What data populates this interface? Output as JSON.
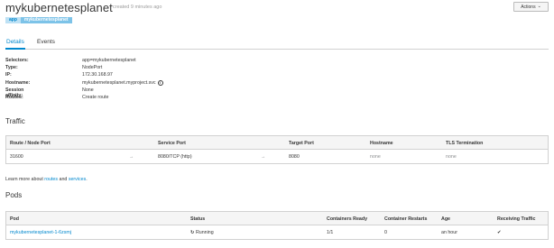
{
  "header": {
    "title": "mykubernetesplanet",
    "subtitle": "created 9 minutes ago",
    "actions_label": "Actions",
    "actions_caret": "⌄"
  },
  "labels": [
    {
      "key": "app",
      "value": "mykubernetesplanet"
    }
  ],
  "tabs": [
    {
      "label": "Details",
      "active": true
    },
    {
      "label": "Events",
      "active": false
    }
  ],
  "details": [
    {
      "key": "Selectors:",
      "value": "app=mykubernetesplanet"
    },
    {
      "key": "Type:",
      "value": "NodePort"
    },
    {
      "key": "IP:",
      "value": "172.30.168.97"
    },
    {
      "key": "Hostname:",
      "value": "mykubernetesplanet.myproject.svc",
      "info_icon": "i"
    },
    {
      "key": "Session affinity:",
      "value": "None"
    },
    {
      "key": "Routes:",
      "value": "Create route"
    }
  ],
  "traffic": {
    "title": "Traffic",
    "headers": [
      "Route / Node Port",
      "Service Port",
      "Target Port",
      "Hostname",
      "TLS Termination"
    ],
    "rows": [
      {
        "route": "31600",
        "arrow1": "→",
        "service_port": "8080/TCP (http)",
        "arrow2": "→",
        "target_port": "8080",
        "hostname": "none",
        "tls": "none"
      }
    ]
  },
  "learn_more": {
    "prefix": "Learn more about ",
    "routes_link": "routes",
    "and": " and ",
    "services_link": "services",
    "suffix": "."
  },
  "pods": {
    "title": "Pods",
    "headers": [
      "Pod",
      "Status",
      "Containers Ready",
      "Container Restarts",
      "Age",
      "Receiving Traffic"
    ],
    "rows": [
      {
        "pod": "mykubernetesplanet-1-6zsmj",
        "status_icon": "↻",
        "status": "Running",
        "ready": "1/1",
        "restarts": "0",
        "age": "an hour",
        "receiving": "✔"
      }
    ]
  },
  "colors": {
    "link": "#0088ce",
    "label_key_bg": "#bee1f4",
    "label_value_bg": "#7dc3e8"
  }
}
